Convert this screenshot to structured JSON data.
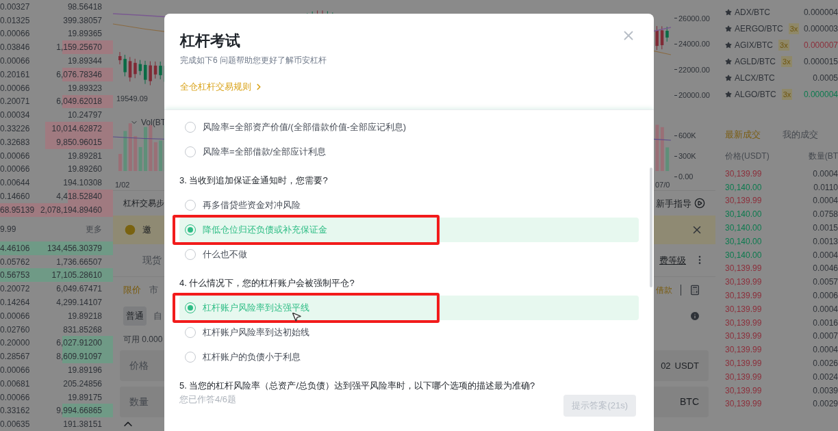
{
  "order_book": {
    "asks": [
      {
        "amount": "0.00327",
        "total": "98.56418"
      },
      {
        "amount": "0.01325",
        "total": "399.38057"
      },
      {
        "amount": "0.00066",
        "total": "19.89365"
      },
      {
        "amount": "0.03846",
        "total": "1,159.25670",
        "level": 0.45
      },
      {
        "amount": "0.00066",
        "total": "19.89344"
      },
      {
        "amount": "0.20161",
        "total": "6,076.78346",
        "level": 0.45
      },
      {
        "amount": "0.00066",
        "total": "19.89323"
      },
      {
        "amount": "0.20071",
        "total": "6,049.62018",
        "level": 0.45
      },
      {
        "amount": "0.00034",
        "total": "10.24797"
      },
      {
        "amount": "0.33226",
        "total": "10,014.62872",
        "level": 0.6
      },
      {
        "amount": "0.32683",
        "total": "9,850.96015",
        "level": 0.6
      },
      {
        "amount": "0.00066",
        "total": "19.89281"
      },
      {
        "amount": "0.00066",
        "total": "19.89260"
      },
      {
        "amount": "0.00644",
        "total": "194.10308"
      },
      {
        "amount": "0.14660",
        "total": "4,418.52840",
        "level": 0.4
      },
      {
        "amount": "68.95139",
        "total": "2,078,194.89460",
        "level": 1
      }
    ],
    "mid_price": "9.99",
    "more": "更多",
    "bids": [
      {
        "amount": "4.46106",
        "total": "134,456.30379",
        "level": 1
      },
      {
        "amount": "0.05762",
        "total": "1,736.66507"
      },
      {
        "amount": "0.56753",
        "total": "17,105.28610",
        "level": 1
      },
      {
        "amount": "0.20072",
        "total": "6,049.67471"
      },
      {
        "amount": "0.14264",
        "total": "4,299.14107"
      },
      {
        "amount": "0.00066",
        "total": "19.89218"
      },
      {
        "amount": "0.02760",
        "total": "831.85268"
      },
      {
        "amount": "0.20000",
        "total": "6,027.91200",
        "level": 0.45
      },
      {
        "amount": "0.28567",
        "total": "8,609.91097",
        "level": 0.45
      },
      {
        "amount": "0.00066",
        "total": "19.89196"
      },
      {
        "amount": "0.00681",
        "total": "205.24856"
      },
      {
        "amount": "0.00066",
        "total": "19.89175"
      },
      {
        "amount": "0.33162",
        "total": "9,994.66865",
        "level": 0.45
      },
      {
        "amount": "0.00635",
        "total": "191.38151"
      }
    ]
  },
  "chart": {
    "price_ticks": [
      "26000.00",
      "24000.00",
      "22000.00",
      "20000.00"
    ],
    "volume_ticks": [
      "600K",
      "300K",
      "0.00"
    ],
    "low_label": "19549.09",
    "volume_label": "Vol(BT",
    "dates": [
      "1/02",
      "07/0"
    ]
  },
  "trade_panel": {
    "steps_label": "杠杆交易步",
    "guide": "新手指导",
    "banner": "邀",
    "tab": "现货",
    "fee_link": "费等级",
    "order_types": [
      {
        "label": "限价",
        "selected": true
      },
      {
        "label": "市",
        "selected": false
      }
    ],
    "borrow": "借款",
    "modes": [
      {
        "label": "普通",
        "selected": true
      },
      {
        "label": "自",
        "selected": false
      }
    ],
    "available": "可用 0.000",
    "price_field": {
      "label": "价格",
      "value": "02",
      "unit": "USDT"
    },
    "amount_field": {
      "label": "数量",
      "unit": "BTC"
    }
  },
  "markets": [
    {
      "pair": "ADX/BTC",
      "price": "0.000004",
      "color": "#2e3238"
    },
    {
      "pair": "AERGO/BTC",
      "badge": "3x",
      "price": "0.000003",
      "color": "#2e3238"
    },
    {
      "pair": "AGIX/BTC",
      "badge": "3x",
      "price": "0.000007",
      "color": "#8c2f3b"
    },
    {
      "pair": "AGLD/BTC",
      "badge": "3x",
      "price": "0.000015",
      "color": "#2e3238"
    },
    {
      "pair": "ALCX/BTC",
      "price": "0.0005",
      "color": "#2e3238"
    },
    {
      "pair": "ALGO/BTC",
      "badge": "3x",
      "price": "0.000004",
      "color": "#0b7a4e"
    }
  ],
  "trades": {
    "tabs": [
      {
        "label": "最新成交",
        "selected": true
      },
      {
        "label": "我的成交",
        "selected": false
      }
    ],
    "columns": [
      "价格(USDT)",
      "数量(BT"
    ],
    "rows": [
      {
        "price": "30,139.99",
        "amount": "0.0004",
        "color": "#8c2f3b"
      },
      {
        "price": "30,140.00",
        "amount": "0.0110",
        "color": "#0b7a4e"
      },
      {
        "price": "30,139.99",
        "amount": "0.0004",
        "color": "#8c2f3b"
      },
      {
        "price": "30,140.00",
        "amount": "0.0758",
        "color": "#0b7a4e"
      },
      {
        "price": "30,140.00",
        "amount": "0.0015",
        "color": "#0b7a4e"
      },
      {
        "price": "30,140.00",
        "amount": "0.0013",
        "color": "#0b7a4e"
      },
      {
        "price": "30,140.00",
        "amount": "0.0004",
        "color": "#0b7a4e"
      },
      {
        "price": "30,139.99",
        "amount": "0.0046",
        "color": "#8c2f3b"
      },
      {
        "price": "30,139.99",
        "amount": "0.0057",
        "color": "#8c2f3b"
      },
      {
        "price": "30,139.99",
        "amount": "0.0006",
        "color": "#8c2f3b"
      },
      {
        "price": "30,139.99",
        "amount": "0.0004",
        "color": "#8c2f3b"
      },
      {
        "price": "30,139.99",
        "amount": "0.0016",
        "color": "#8c2f3b"
      },
      {
        "price": "30,139.99",
        "amount": "0.0007",
        "color": "#8c2f3b"
      },
      {
        "price": "30,139.99",
        "amount": "0.0004",
        "color": "#8c2f3b"
      },
      {
        "price": "30,139.99",
        "amount": "0.0026",
        "color": "#8c2f3b"
      },
      {
        "price": "30,139.99",
        "amount": "0.0024",
        "color": "#8c2f3b"
      },
      {
        "price": "30,139.99",
        "amount": "0.0039",
        "color": "#8c2f3b"
      },
      {
        "price": "30,139.99",
        "amount": "0.0029",
        "color": "#8c2f3b"
      }
    ]
  },
  "dialog": {
    "title": "杠杆考试",
    "subtitle": "完成如下6 问题帮助您更好了解币安杠杆",
    "rules_link": "全仓杠杆交易规则",
    "questions": [
      {
        "options": [
          {
            "label": "风险率=全部资产价值/(全部借款价值-全部应记利息)",
            "selected": false,
            "annotated": false
          },
          {
            "label": "风险率=全部借款/全部应计利息",
            "selected": false,
            "annotated": false
          }
        ]
      },
      {
        "text": "3. 当收到追加保证金通知时，您需要?",
        "options": [
          {
            "label": "再多借贷些资金对冲风险",
            "selected": false,
            "annotated": false
          },
          {
            "label": "降低仓位归还负债或补充保证金",
            "selected": true,
            "annotated": true
          },
          {
            "label": "什么也不做",
            "selected": false,
            "annotated": false
          }
        ]
      },
      {
        "text": "4. 什么情况下，您的杠杆账户会被强制平仓?",
        "options": [
          {
            "label": "杠杆账户风险率到达强平线",
            "selected": true,
            "annotated": true
          },
          {
            "label": "杠杆账户风险率到达初始线",
            "selected": false,
            "annotated": false
          },
          {
            "label": "杠杆账户的负债小于利息",
            "selected": false,
            "annotated": false
          }
        ]
      },
      {
        "text": "5. 当您的杠杆风险率（总资产/总负债）达到强平风险率时，以下哪个选项的描述最为准确?"
      }
    ],
    "progress": "您已作答4/6题",
    "hint_button": {
      "label": "提示答案(21s)",
      "disabled": true
    }
  }
}
